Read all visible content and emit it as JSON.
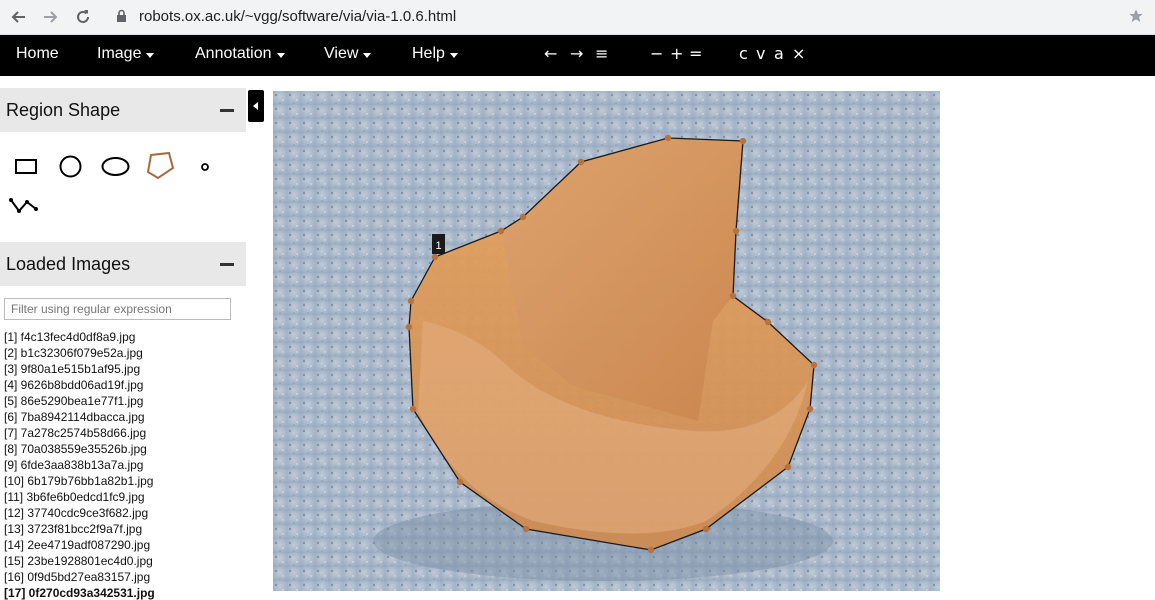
{
  "browser": {
    "url": "robots.ox.ac.uk/~vgg/software/via/via-1.0.6.html",
    "back_icon": "arrow-left-icon",
    "forward_icon": "arrow-right-icon",
    "reload_icon": "reload-icon",
    "secure_icon": "lock-icon",
    "bookmark_icon": "star-icon"
  },
  "menu": {
    "home": "Home",
    "image": "Image",
    "annotation": "Annotation",
    "view": "View",
    "help": "Help",
    "tools": {
      "prev": "←",
      "next": "→",
      "list": "≡",
      "zoom_out": "−",
      "zoom_in": "+",
      "zoom_reset": "=",
      "copy": "c",
      "paste": "v",
      "select_all": "a",
      "delete": "×"
    }
  },
  "region_shape": {
    "title": "Region Shape",
    "shapes": [
      "rectangle",
      "circle",
      "ellipse",
      "polygon",
      "point",
      "polyline"
    ],
    "selected": "polygon"
  },
  "loaded_images": {
    "title": "Loaded Images",
    "filter_placeholder": "Filter using regular expression",
    "items": [
      "[1] f4c13fec4d0df8a9.jpg",
      "[2] b1c32306f079e52a.jpg",
      "[3] 9f80a1e515b1af95.jpg",
      "[4] 9626b8bdd06ad19f.jpg",
      "[5] 86e5290bea1e77f1.jpg",
      "[6] 7ba8942114dbacca.jpg",
      "[7] 7a278c2574b58d66.jpg",
      "[8] 70a038559e35526b.jpg",
      "[9] 6fde3aa838b13a7a.jpg",
      "[10] 6b179b76bb1a82b1.jpg",
      "[11] 3b6fe6b0edcd1fc9.jpg",
      "[12] 37740cdc9ce3f682.jpg",
      "[13] 3723f81bcc2f9a7f.jpg",
      "[14] 2ee4719adf087290.jpg",
      "[15] 23be1928801ec4d0.jpg",
      "[16] 0f9d5bd27ea83157.jpg",
      "[17] 0f270cd93a342531.jpg"
    ],
    "active_index": 16
  },
  "canvas": {
    "region_label": "1",
    "region_shape": "polygon",
    "colors": {
      "background": "#a7b7cc",
      "region_fill": "#e39b58",
      "vertex": "#b5733f",
      "outline": "#1a1a1a"
    }
  }
}
